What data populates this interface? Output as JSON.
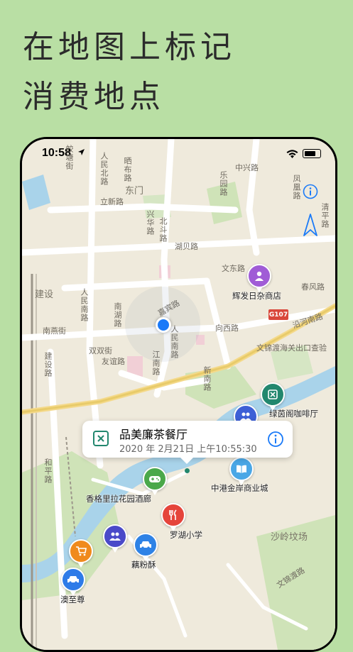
{
  "promo": {
    "line1": "在地图上标记",
    "line2": "消费地点"
  },
  "status_bar": {
    "time": "10:58"
  },
  "map_labels": {
    "dongmen": "东门",
    "jianshe": "建设",
    "shaling": "沙岭坟场",
    "jiaotangjie": "蛟塘街",
    "renminbeilu": "人民北路",
    "liwenlu": "立新路",
    "zhonghuaroad": "晒布路",
    "xingfu": "兴华路",
    "beidou": "北斗路",
    "zhongxinglu": "中兴路",
    "leyuanlu": "乐园路",
    "fenghelu": "凤凰路",
    "qingpinglu": "清平路",
    "hubeilu": "湖贝路",
    "wendonglu": "文东路",
    "chunfenglu": "春风路",
    "hexilu": "向西路",
    "jiabinlu": "嘉宾路",
    "heping": "和平路",
    "jianshelu": "建设路",
    "renminnanlu": "人民南路",
    "nanhulu": "南湖路",
    "nanyanjie": "南燕街",
    "shuangxiaojie": "双双街",
    "youyilu": "友谊路",
    "jiangnan": "江南路",
    "yanhelu": "沿河南路",
    "wenjindu": "文锦渡海关出口查验",
    "renmin2": "人民南路",
    "wenjindulu": "文锦渡路",
    "xinnanlu": "新南路",
    "songyuanlu": "松园路",
    "heping2": "和平路",
    "wenjinbei": "嘉宾路",
    "sign": "G107"
  },
  "pois": [
    {
      "label": "辉发日杂商店",
      "color": "#a05cd6",
      "icon": "person-icon"
    },
    {
      "label": "绿茵阁咖啡厅",
      "color": "#22876e",
      "icon": "restaurant-icon"
    },
    {
      "label": "",
      "color": "#3d5fd6",
      "icon": "people-icon"
    },
    {
      "label": "中港金岸商业城",
      "color": "#4aa7e6",
      "icon": "book-icon"
    },
    {
      "label": "香格里拉花园酒廊",
      "color": "#4aa84a",
      "icon": "gamepad-icon"
    },
    {
      "label": "罗湖小学",
      "color": "#e5443b",
      "icon": "fork-knife-icon"
    },
    {
      "label": "",
      "color": "#4a49c9",
      "icon": "people-icon"
    },
    {
      "label": "藕粉酥",
      "color": "#2e82e6",
      "icon": "car-icon"
    },
    {
      "label": "",
      "color": "#f08a1c",
      "icon": "cart-icon"
    },
    {
      "label": "澳至尊",
      "color": "#2e7be8",
      "icon": "car-icon"
    }
  ],
  "callout": {
    "name": "品美廉茶餐厅",
    "datetime": "2020 年 2月21日 上午10:55:30"
  },
  "colors": {
    "background": "#b9dfa4",
    "accent": "#1a7af8",
    "callout_teal": "#22876e"
  }
}
